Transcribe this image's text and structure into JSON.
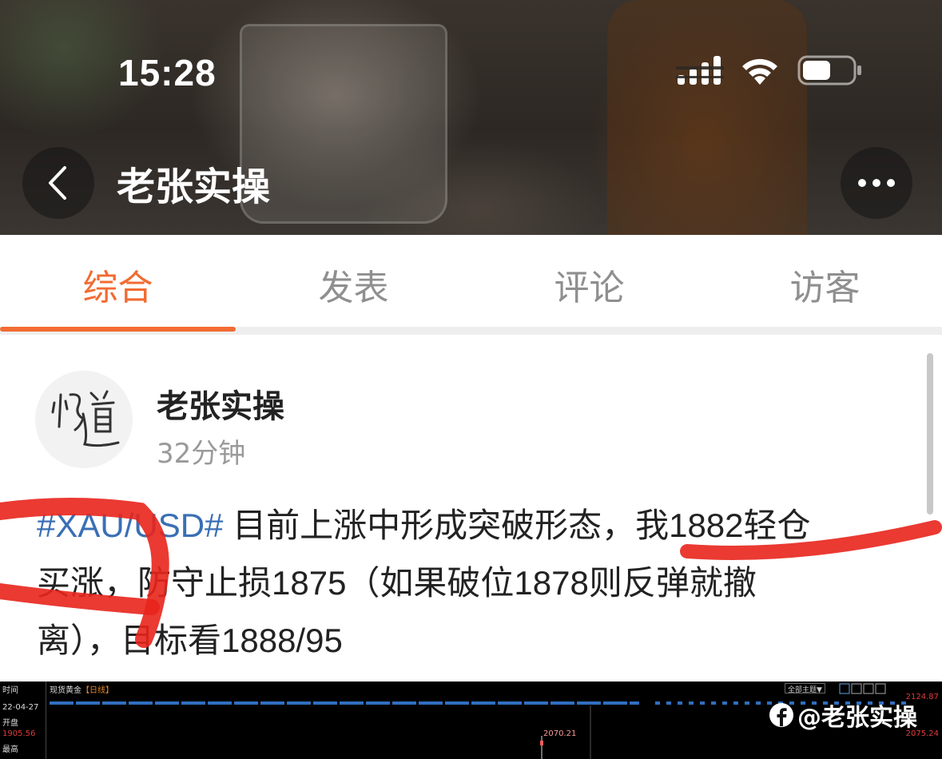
{
  "status_bar": {
    "time": "15:28"
  },
  "header": {
    "title": "老张实操",
    "back_icon": "chevron-left-icon",
    "more_icon": "ellipsis-icon"
  },
  "tabs": [
    {
      "label": "综合",
      "active": true
    },
    {
      "label": "发表",
      "active": false
    },
    {
      "label": "评论",
      "active": false
    },
    {
      "label": "访客",
      "active": false
    }
  ],
  "colors": {
    "accent": "#f26b32",
    "hashtag": "#3a6fb5",
    "annotation": "#e8251c"
  },
  "post": {
    "author": "老张实操",
    "time_ago": "32分钟",
    "hashtag": "#XAU/USD#",
    "lines": [
      " 目前上涨中形成突破形态，我1882轻仓",
      "买涨，防守止损1875（如果破位1878则反弹就撤",
      "离），目标看1888/95"
    ]
  },
  "chart": {
    "title": "现货黄金",
    "timeframe": "【日线】",
    "side_labels": [
      "时间",
      "22-04-27",
      "开盘",
      "1905.56",
      "最高"
    ],
    "toolbar_label": "全部主题▼",
    "price_top": "2124.87",
    "price_right": "2075.24",
    "peak_label": "2070.21"
  },
  "watermark": {
    "text": "@老张实操",
    "icon": "facebook-icon"
  }
}
